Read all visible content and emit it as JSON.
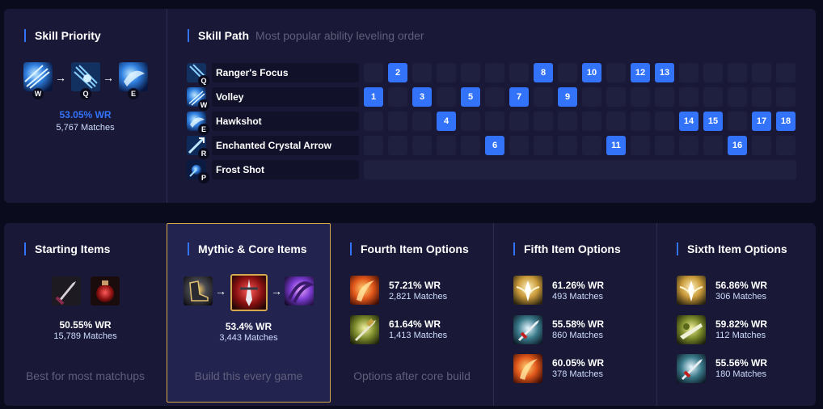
{
  "colors": {
    "accent": "#3273fa",
    "panel": "#191937",
    "background": "#0b0b1e"
  },
  "skill_priority": {
    "title": "Skill Priority",
    "order": [
      {
        "key": "W",
        "icon": "volley-icon"
      },
      {
        "key": "Q",
        "icon": "rangers-focus-icon"
      },
      {
        "key": "E",
        "icon": "hawkshot-icon"
      }
    ],
    "win_rate": "53.05% WR",
    "matches": "5,767 Matches"
  },
  "skill_path": {
    "title": "Skill Path",
    "subtitle": "Most popular ability leveling order",
    "skills": [
      {
        "key": "Q",
        "name": "Ranger's Focus",
        "icon": "rangers-focus-icon",
        "levels": [
          2,
          8,
          10,
          12,
          13
        ]
      },
      {
        "key": "W",
        "name": "Volley",
        "icon": "volley-icon",
        "levels": [
          1,
          3,
          5,
          7,
          9
        ]
      },
      {
        "key": "E",
        "name": "Hawkshot",
        "icon": "hawkshot-icon",
        "levels": [
          4,
          14,
          15,
          17,
          18
        ]
      },
      {
        "key": "R",
        "name": "Enchanted Crystal Arrow",
        "icon": "enchanted-crystal-arrow-icon",
        "levels": [
          6,
          11,
          16
        ]
      },
      {
        "key": "P",
        "name": "Frost Shot",
        "icon": "frost-shot-icon",
        "levels": []
      }
    ]
  },
  "starting_items": {
    "title": "Starting Items",
    "items": [
      "doran-blade-icon",
      "health-potion-icon"
    ],
    "win_rate": "50.55% WR",
    "matches": "15,789 Matches",
    "hint": "Best for most matchups"
  },
  "core_items": {
    "title": "Mythic & Core Items",
    "items": [
      "berserker-greaves-icon",
      "kraken-slayer-icon",
      "runaans-hurricane-icon"
    ],
    "win_rate": "53.4% WR",
    "matches": "3,443 Matches",
    "hint": "Build this every game"
  },
  "fourth_items": {
    "title": "Fourth Item Options",
    "options": [
      {
        "icon": "infinity-edge-icon",
        "win_rate": "57.21% WR",
        "matches": "2,821 Matches"
      },
      {
        "icon": "lord-dominiks-regards-icon",
        "win_rate": "61.64% WR",
        "matches": "1,413 Matches"
      }
    ],
    "hint": "Options after core build"
  },
  "fifth_items": {
    "title": "Fifth Item Options",
    "options": [
      {
        "icon": "guardian-angel-icon",
        "win_rate": "61.26% WR",
        "matches": "493 Matches"
      },
      {
        "icon": "bloodthirster-icon",
        "win_rate": "55.58% WR",
        "matches": "860 Matches"
      },
      {
        "icon": "infinity-edge-icon",
        "win_rate": "60.05% WR",
        "matches": "378 Matches"
      }
    ]
  },
  "sixth_items": {
    "title": "Sixth Item Options",
    "options": [
      {
        "icon": "guardian-angel-icon",
        "win_rate": "56.86% WR",
        "matches": "306 Matches"
      },
      {
        "icon": "mortal-reminder-icon",
        "win_rate": "59.82% WR",
        "matches": "112 Matches"
      },
      {
        "icon": "bloodthirster-icon",
        "win_rate": "55.56% WR",
        "matches": "180 Matches"
      }
    ]
  }
}
